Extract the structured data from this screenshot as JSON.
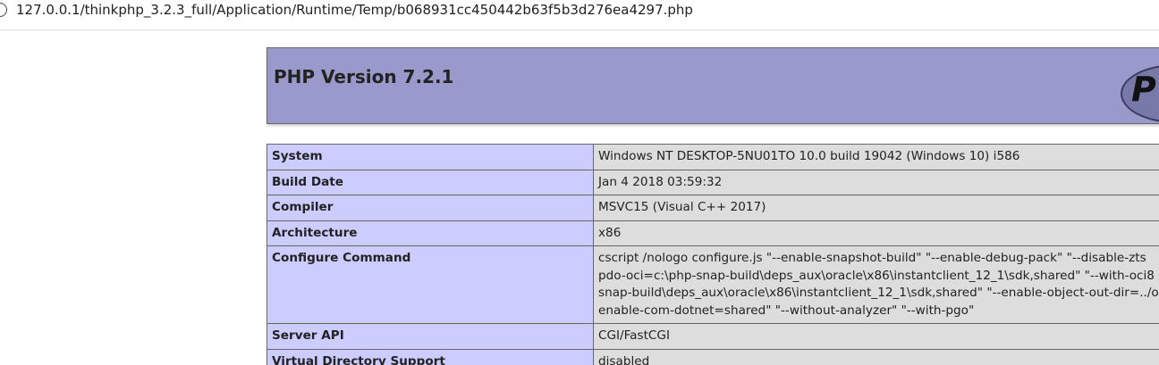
{
  "browser": {
    "url": "127.0.0.1/thinkphp_3.2.3_full/Application/Runtime/Temp/b068931cc450442b63f5b3d276ea4297.php"
  },
  "header": {
    "title": "PHP Version 7.2.1",
    "logo_text": "P"
  },
  "rows": [
    {
      "key": "System",
      "value_lines": [
        "Windows NT DESKTOP-5NU01TO 10.0 build 19042 (Windows 10) i586"
      ]
    },
    {
      "key": "Build Date",
      "value_lines": [
        "Jan 4 2018 03:59:32"
      ]
    },
    {
      "key": "Compiler",
      "value_lines": [
        "MSVC15 (Visual C++ 2017)"
      ]
    },
    {
      "key": "Architecture",
      "value_lines": [
        "x86"
      ]
    },
    {
      "key": "Configure Command",
      "value_lines": [
        "cscript /nologo configure.js \"--enable-snapshot-build\" \"--enable-debug-pack\" \"--disable-zts",
        "pdo-oci=c:\\php-snap-build\\deps_aux\\oracle\\x86\\instantclient_12_1\\sdk,shared\" \"--with-oci8",
        "snap-build\\deps_aux\\oracle\\x86\\instantclient_12_1\\sdk,shared\" \"--enable-object-out-dir=../o",
        "enable-com-dotnet=shared\" \"--without-analyzer\" \"--with-pgo\""
      ]
    },
    {
      "key": "Server API",
      "value_lines": [
        "CGI/FastCGI"
      ]
    },
    {
      "key": "Virtual Directory Support",
      "value_lines": [
        "disabled"
      ]
    }
  ]
}
